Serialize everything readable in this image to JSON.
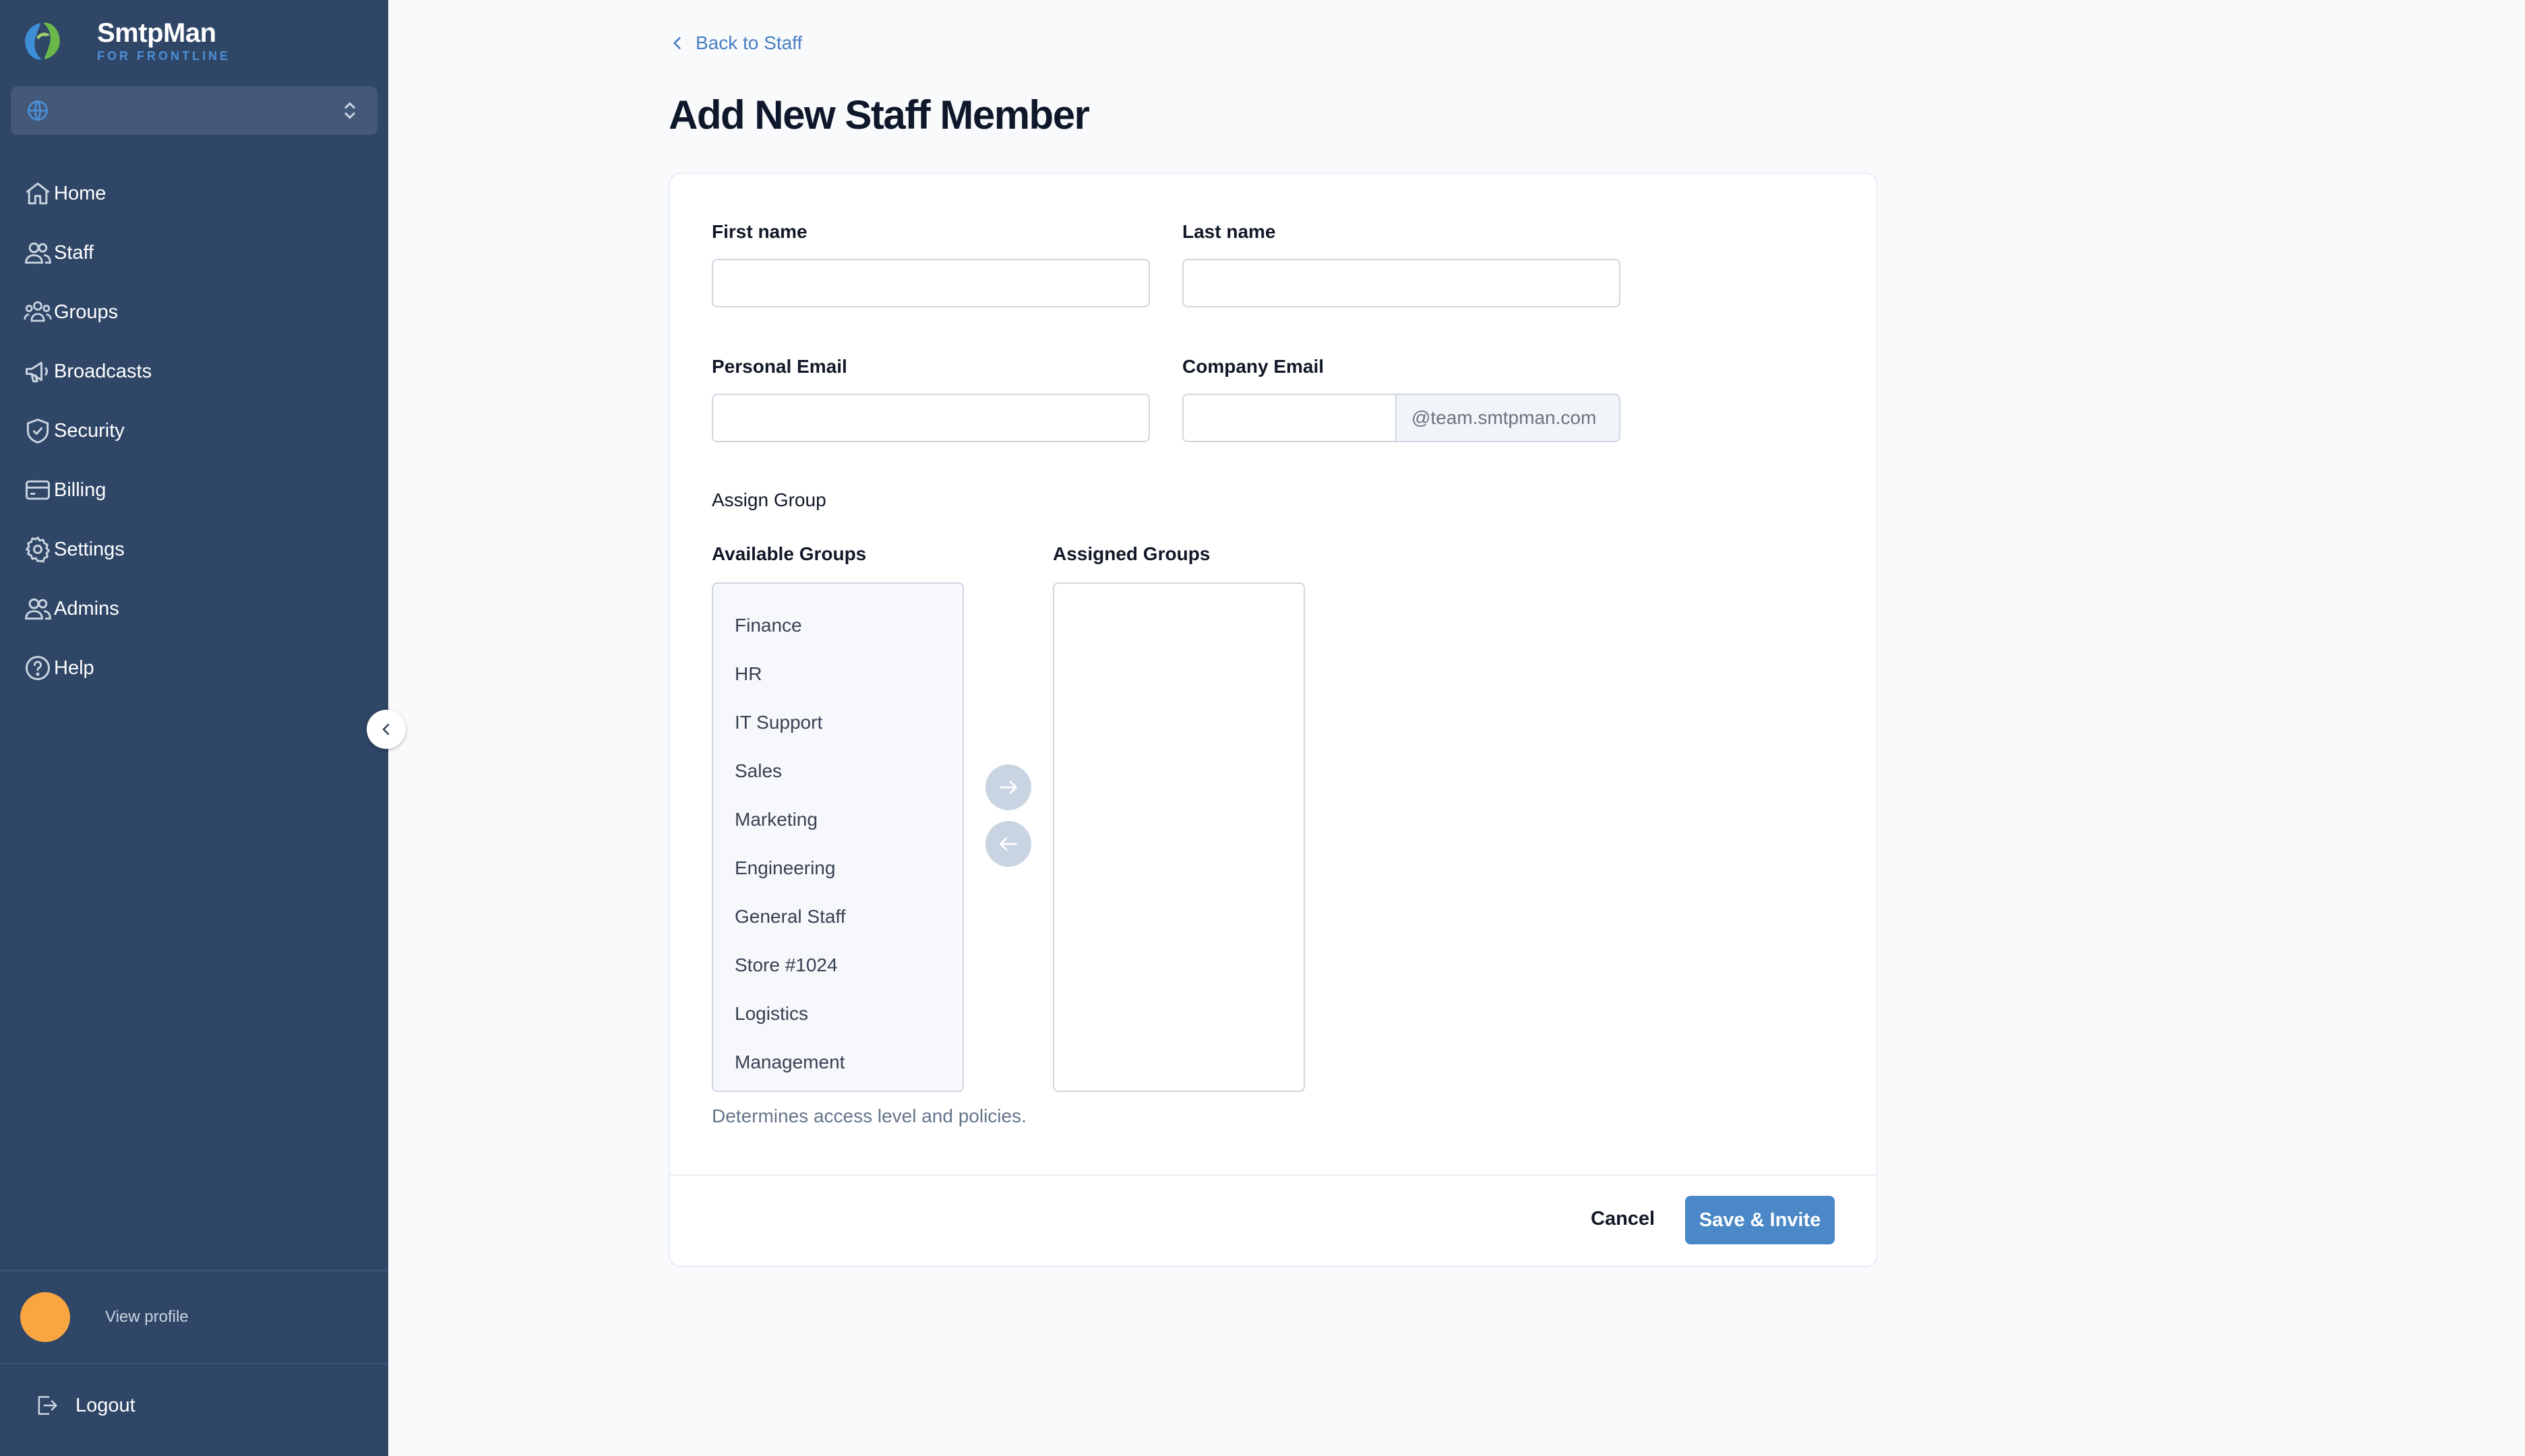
{
  "brand": {
    "name": "SmtpMan",
    "tagline": "FOR FRONTLINE"
  },
  "workspace_selector": {
    "icon": "globe-icon",
    "value": ""
  },
  "sidebar": {
    "items": [
      {
        "label": "Home",
        "icon": "home-icon"
      },
      {
        "label": "Staff",
        "icon": "users-icon"
      },
      {
        "label": "Groups",
        "icon": "groups-icon"
      },
      {
        "label": "Broadcasts",
        "icon": "megaphone-icon"
      },
      {
        "label": "Security",
        "icon": "shield-check-icon"
      },
      {
        "label": "Billing",
        "icon": "credit-card-icon"
      },
      {
        "label": "Settings",
        "icon": "gear-icon"
      },
      {
        "label": "Admins",
        "icon": "users-icon"
      },
      {
        "label": "Help",
        "icon": "help-circle-icon"
      }
    ],
    "profile_label": "View profile",
    "logout_label": "Logout"
  },
  "page": {
    "back_link": "Back to Staff",
    "title": "Add New Staff Member"
  },
  "form": {
    "first_name": {
      "label": "First name",
      "value": ""
    },
    "last_name": {
      "label": "Last name",
      "value": ""
    },
    "personal_email": {
      "label": "Personal Email",
      "value": ""
    },
    "company_email": {
      "label": "Company Email",
      "value": "",
      "suffix": "@team.smtpman.com"
    },
    "assign_group": {
      "label": "Assign Group",
      "available_label": "Available Groups",
      "assigned_label": "Assigned Groups",
      "available": [
        "Finance",
        "HR",
        "IT Support",
        "Sales",
        "Marketing",
        "Engineering",
        "General Staff",
        "Store #1024",
        "Logistics",
        "Management"
      ],
      "assigned": [],
      "help": "Determines access level and policies."
    }
  },
  "footer": {
    "cancel_label": "Cancel",
    "submit_label": "Save & Invite"
  },
  "colors": {
    "sidebar_bg": "#2f4667",
    "primary": "#4a88c7",
    "link": "#4a7fc1",
    "avatar": "#f7a642",
    "brand_accent": "#4b8fd6"
  }
}
